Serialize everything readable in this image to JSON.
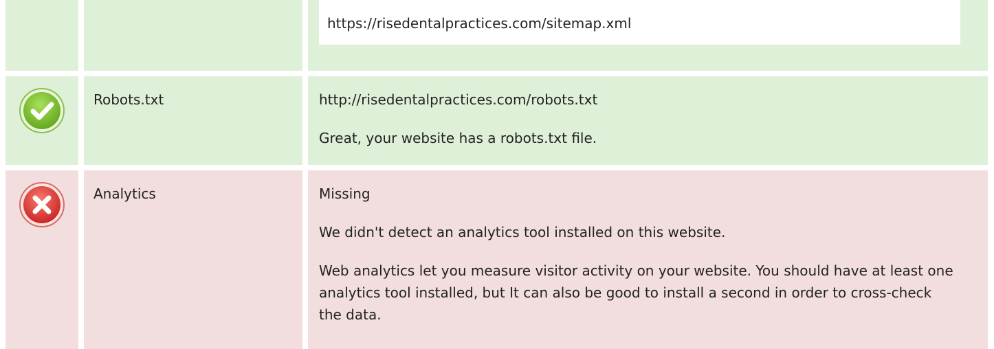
{
  "rows": [
    {
      "id": "sitemap",
      "status": "pass",
      "url_text": "https://risedentalpractices.com/sitemap.xml"
    },
    {
      "id": "robots",
      "status": "pass",
      "label": "Robots.txt",
      "value": "http://risedentalpractices.com/robots.txt",
      "message": "Great, your website has a robots.txt file."
    },
    {
      "id": "analytics",
      "status": "fail",
      "label": "Analytics",
      "value": "Missing",
      "message": "We didn't detect an analytics tool installed on this website.",
      "details": "Web analytics let you measure visitor activity on your website. You should have at least one analytics tool installed, but It can also be good to install a second in order to cross-check the data."
    }
  ],
  "icons": {
    "pass": "check-circle-icon",
    "fail": "x-circle-icon"
  },
  "colors": {
    "pass_bg": "#dff0d8",
    "fail_bg": "#f2dede",
    "pass_icon": "#7cc22e",
    "fail_icon": "#e0393a"
  }
}
